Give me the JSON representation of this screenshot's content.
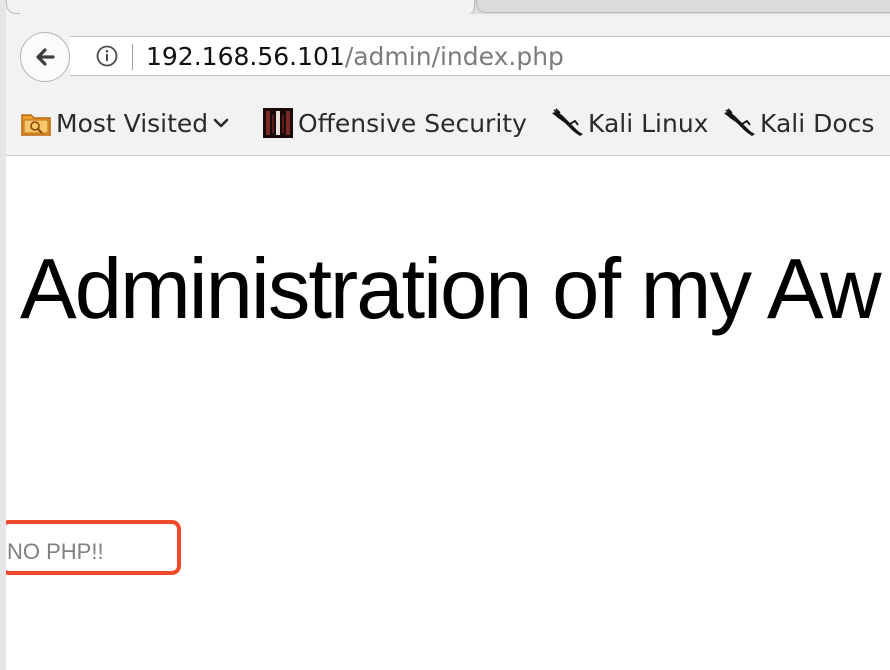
{
  "browser": {
    "url": {
      "host": "192.168.56.101",
      "path": "/admin/index.php"
    },
    "bookmarks": [
      {
        "label": "Most Visited",
        "icon": "folder-icon",
        "has_dropdown": true
      },
      {
        "label": "Offensive Security",
        "icon": "offensive-security-icon"
      },
      {
        "label": "Kali Linux",
        "icon": "kali-dragon-icon"
      },
      {
        "label": "Kali Docs",
        "icon": "kali-dragon-icon"
      }
    ]
  },
  "page": {
    "heading": "Administration of my Aw",
    "message": "NO PHP!!"
  },
  "colors": {
    "highlight": "#ee4b2b",
    "chrome": "#f2f2f2",
    "message_text": "#808080"
  }
}
